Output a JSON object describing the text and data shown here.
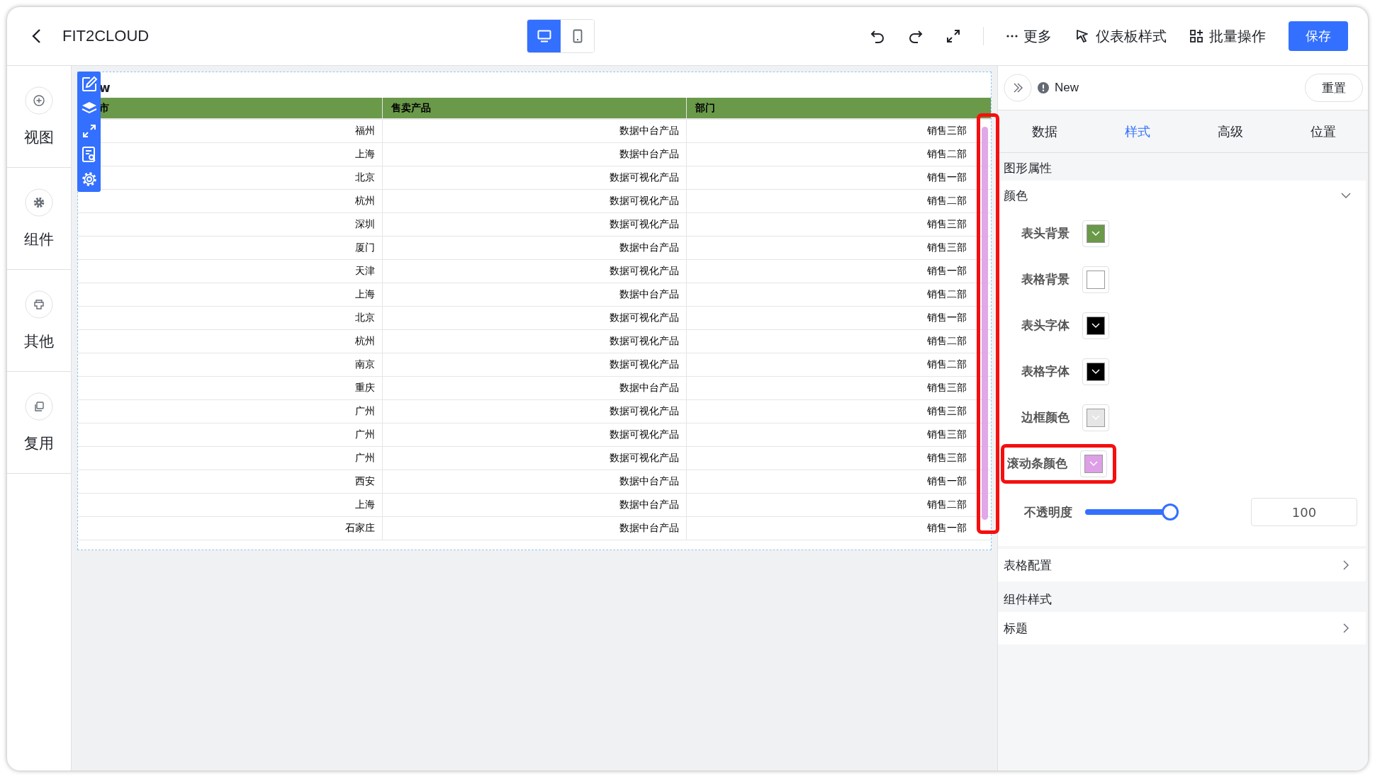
{
  "header": {
    "title": "FIT2CLOUD",
    "device_modes": [
      {
        "kind": "desktop",
        "selected": true
      },
      {
        "kind": "mobile",
        "selected": false
      }
    ],
    "actions": [
      {
        "kind": "more",
        "label": "更多"
      },
      {
        "kind": "style",
        "label": "仪表板样式"
      },
      {
        "kind": "batch",
        "label": "批量操作"
      }
    ],
    "save_button": "保存"
  },
  "sidebar": {
    "items": [
      {
        "kind": "add",
        "label": "视图"
      },
      {
        "kind": "gear",
        "label": "组件"
      },
      {
        "kind": "other",
        "label": "其他"
      },
      {
        "kind": "copy",
        "label": "复用"
      }
    ]
  },
  "table_widget": {
    "title": "w",
    "columns": [
      "市",
      "售卖产品",
      "部门"
    ],
    "rows": [
      [
        "福州",
        "数据中台产品",
        "销售三部"
      ],
      [
        "上海",
        "数据中台产品",
        "销售二部"
      ],
      [
        "北京",
        "数据可视化产品",
        "销售一部"
      ],
      [
        "杭州",
        "数据可视化产品",
        "销售二部"
      ],
      [
        "深圳",
        "数据可视化产品",
        "销售三部"
      ],
      [
        "厦门",
        "数据中台产品",
        "销售三部"
      ],
      [
        "天津",
        "数据可视化产品",
        "销售一部"
      ],
      [
        "上海",
        "数据中台产品",
        "销售二部"
      ],
      [
        "北京",
        "数据可视化产品",
        "销售一部"
      ],
      [
        "杭州",
        "数据可视化产品",
        "销售二部"
      ],
      [
        "南京",
        "数据可视化产品",
        "销售二部"
      ],
      [
        "重庆",
        "数据中台产品",
        "销售三部"
      ],
      [
        "广州",
        "数据可视化产品",
        "销售三部"
      ],
      [
        "广州",
        "数据可视化产品",
        "销售三部"
      ],
      [
        "广州",
        "数据可视化产品",
        "销售三部"
      ],
      [
        "西安",
        "数据中台产品",
        "销售一部"
      ],
      [
        "上海",
        "数据中台产品",
        "销售二部"
      ],
      [
        "石家庄",
        "数据中台产品",
        "销售一部"
      ]
    ],
    "scrollbar_highlighted": true
  },
  "panel": {
    "title": "New",
    "reset_button": "重置",
    "tabs": [
      {
        "label": "数据",
        "selected": false
      },
      {
        "label": "样式",
        "selected": true
      },
      {
        "label": "高级",
        "selected": false
      },
      {
        "label": "位置",
        "selected": false
      }
    ],
    "section": "图形属性",
    "color_group": {
      "label": "颜色",
      "expanded": true
    },
    "color_settings": [
      {
        "label": "表头背景",
        "color": "#6a994a",
        "highlighted": false
      },
      {
        "label": "表格背景",
        "color": "#ffffff",
        "highlighted": false
      },
      {
        "label": "表头字体",
        "color": "#000000",
        "highlighted": false
      },
      {
        "label": "表格字体",
        "color": "#000000",
        "highlighted": false
      },
      {
        "label": "边框颜色",
        "color": "#e6e6e6",
        "highlighted": false
      },
      {
        "label": "滚动条颜色",
        "color": "#dd9fe6",
        "highlighted": true
      }
    ],
    "opacity": {
      "label": "不透明度",
      "level": 1,
      "value": "100"
    },
    "table_config": "表格配置",
    "component_style": "组件样式",
    "title_item": "标题"
  }
}
